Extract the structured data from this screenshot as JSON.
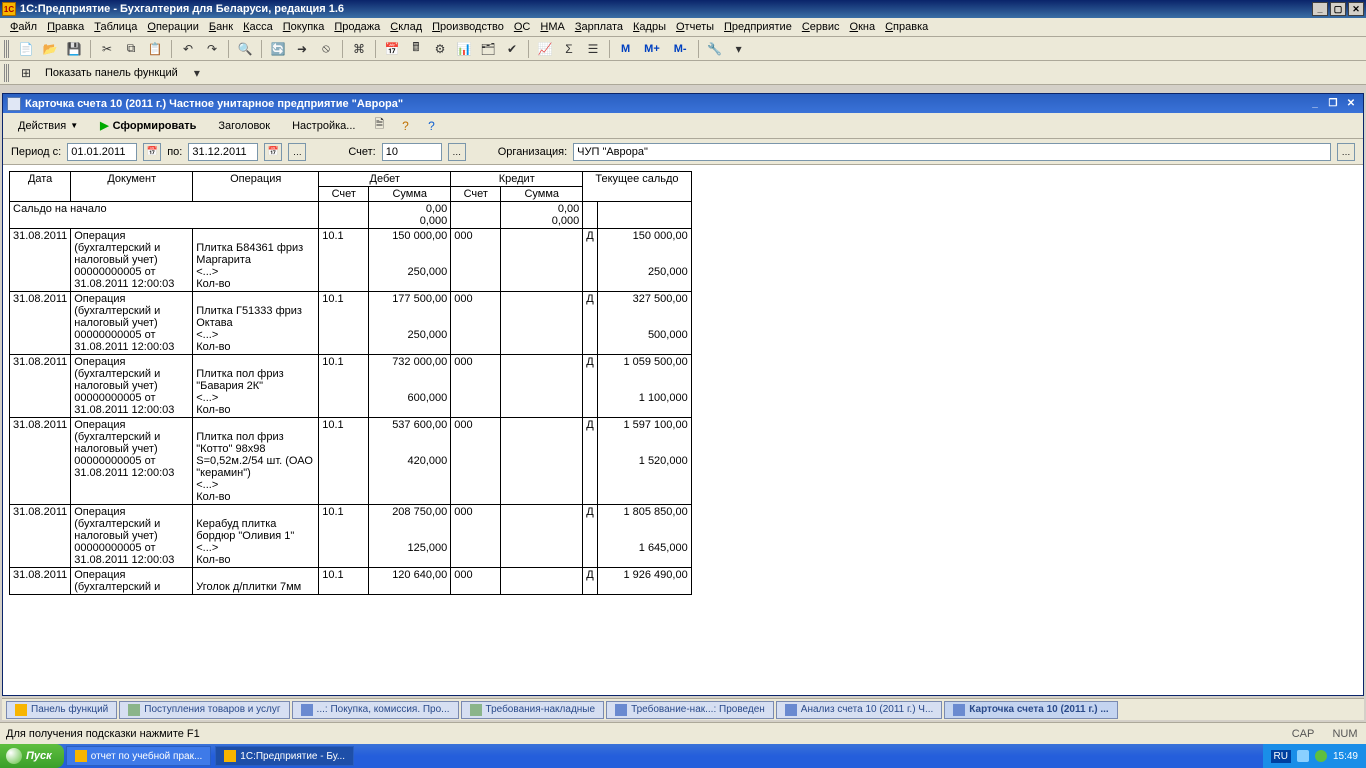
{
  "app": {
    "title": "1С:Предприятие - Бухгалтерия для Беларуси, редакция 1.6"
  },
  "main_menu": [
    "Файл",
    "Правка",
    "Таблица",
    "Операции",
    "Банк",
    "Касса",
    "Покупка",
    "Продажа",
    "Склад",
    "Производство",
    "ОС",
    "НМА",
    "Зарплата",
    "Кадры",
    "Отчеты",
    "Предприятие",
    "Сервис",
    "Окна",
    "Справка"
  ],
  "toolbar_panel_label": "Показать панель функций",
  "toolbar_m_labels": {
    "m": "M",
    "mp": "M+",
    "mm": "M-"
  },
  "child_window": {
    "title": "Карточка счета 10 (2011 г.)  Частное унитарное предприятие \"Аврора\"",
    "actions_label": "Действия",
    "form_btn": "Сформировать",
    "header_btn": "Заголовок",
    "settings_btn": "Настройка..."
  },
  "params": {
    "period_label": "Период с:",
    "date_from": "01.01.2011",
    "to_label": "по:",
    "date_to": "31.12.2011",
    "account_label": "Счет:",
    "account_value": "10",
    "org_label": "Организация:",
    "org_value": "ЧУП \"Аврора\""
  },
  "report_headers": {
    "date": "Дата",
    "doc": "Документ",
    "op": "Операция",
    "debit": "Дебет",
    "credit": "Кредит",
    "balance": "Текущее сальдо",
    "account": "Счет",
    "sum": "Сумма"
  },
  "opening_balance_label": "Сальдо на начало",
  "opening": {
    "debit_sum": "0,00",
    "debit_qty": "0,000",
    "credit_sum": "0,00",
    "credit_qty": "0,000"
  },
  "rows": [
    {
      "date": "31.08.2011",
      "doc": "Операция (бухгалтерский и налоговый учет) 00000000005 от 31.08.2011 12:00:03",
      "op": "Плитка Б84361 фриз Маргарита\n<...>\nКол-во",
      "d_acc": "10.1",
      "d_sum": "150 000,00",
      "d_qty": "250,000",
      "c_acc": "000",
      "c_sum": "",
      "b_flag": "Д",
      "b_sum": "150 000,00",
      "b_qty": "250,000"
    },
    {
      "date": "31.08.2011",
      "doc": "Операция (бухгалтерский и налоговый учет) 00000000005 от 31.08.2011 12:00:03",
      "op": "Плитка Г51333 фриз Октава\n<...>\nКол-во",
      "d_acc": "10.1",
      "d_sum": "177 500,00",
      "d_qty": "250,000",
      "c_acc": "000",
      "c_sum": "",
      "b_flag": "Д",
      "b_sum": "327 500,00",
      "b_qty": "500,000"
    },
    {
      "date": "31.08.2011",
      "doc": "Операция (бухгалтерский и налоговый учет) 00000000005 от 31.08.2011 12:00:03",
      "op": "Плитка пол фриз \"Бавария 2К\"\n<...>\nКол-во",
      "d_acc": "10.1",
      "d_sum": "732 000,00",
      "d_qty": "600,000",
      "c_acc": "000",
      "c_sum": "",
      "b_flag": "Д",
      "b_sum": "1 059 500,00",
      "b_qty": "1 100,000"
    },
    {
      "date": "31.08.2011",
      "doc": "Операция (бухгалтерский и налоговый учет) 00000000005 от 31.08.2011 12:00:03",
      "op": "Плитка пол фриз \"Котто\" 98х98 S=0,52м.2/54 шт. (ОАО \"керамин\")\n<...>\nКол-во",
      "d_acc": "10.1",
      "d_sum": "537 600,00",
      "d_qty": "420,000",
      "c_acc": "000",
      "c_sum": "",
      "b_flag": "Д",
      "b_sum": "1 597 100,00",
      "b_qty": "1 520,000"
    },
    {
      "date": "31.08.2011",
      "doc": "Операция (бухгалтерский и налоговый учет) 00000000005 от 31.08.2011 12:00:03",
      "op": "Керабуд плитка бордюр \"Оливия 1\"\n<...>\nКол-во",
      "d_acc": "10.1",
      "d_sum": "208 750,00",
      "d_qty": "125,000",
      "c_acc": "000",
      "c_sum": "",
      "b_flag": "Д",
      "b_sum": "1 805 850,00",
      "b_qty": "1 645,000"
    },
    {
      "date": "31.08.2011",
      "doc": "Операция (бухгалтерский и",
      "op": "Уголок д/плитки 7мм",
      "d_acc": "10.1",
      "d_sum": "120 640,00",
      "d_qty": "",
      "c_acc": "000",
      "c_sum": "",
      "b_flag": "Д",
      "b_sum": "1 926 490,00",
      "b_qty": ""
    }
  ],
  "mdi_tabs": [
    {
      "label": "Панель функций",
      "kind": "panel"
    },
    {
      "label": "Поступления товаров и услуг",
      "kind": "docs"
    },
    {
      "label": "...: Покупка, комиссия. Про...",
      "kind": "report"
    },
    {
      "label": "Требования-накладные",
      "kind": "docs"
    },
    {
      "label": "Требование-нак...: Проведен",
      "kind": "report"
    },
    {
      "label": "Анализ счета 10 (2011 г.) Ч...",
      "kind": "report"
    },
    {
      "label": "Карточка счета 10 (2011 г.) ...",
      "kind": "report",
      "active": true
    }
  ],
  "hint_text": "Для получения подсказки нажмите F1",
  "status_right": {
    "cap": "CAP",
    "num": "NUM"
  },
  "taskbar": {
    "start": "Пуск",
    "items": [
      {
        "label": "отчет по учебной прак..."
      },
      {
        "label": "1С:Предприятие - Бу...",
        "active": true
      }
    ],
    "clock": "15:49",
    "lang": "RU"
  }
}
